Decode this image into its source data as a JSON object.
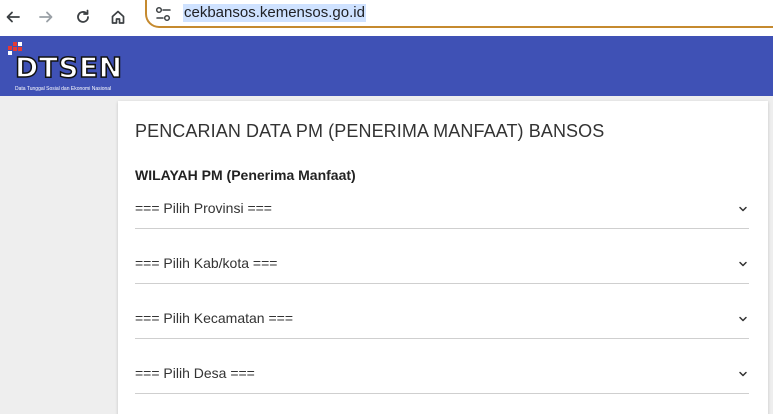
{
  "browser": {
    "url": "cekbansos.kemensos.go.id"
  },
  "header": {
    "logo_text": "DTSEN",
    "logo_subtitle": "Data Tunggal Sosial dan Ekonomi Nasional",
    "bar_color": "#3f51b5"
  },
  "form": {
    "title": "PENCARIAN DATA PM (PENERIMA MANFAAT) BANSOS",
    "section_title": "WILAYAH PM (Penerima Manfaat)",
    "selects": [
      {
        "label": "=== Pilih Provinsi ==="
      },
      {
        "label": "=== Pilih Kab/kota ==="
      },
      {
        "label": "=== Pilih Kecamatan ==="
      },
      {
        "label": "=== Pilih Desa ==="
      }
    ]
  }
}
